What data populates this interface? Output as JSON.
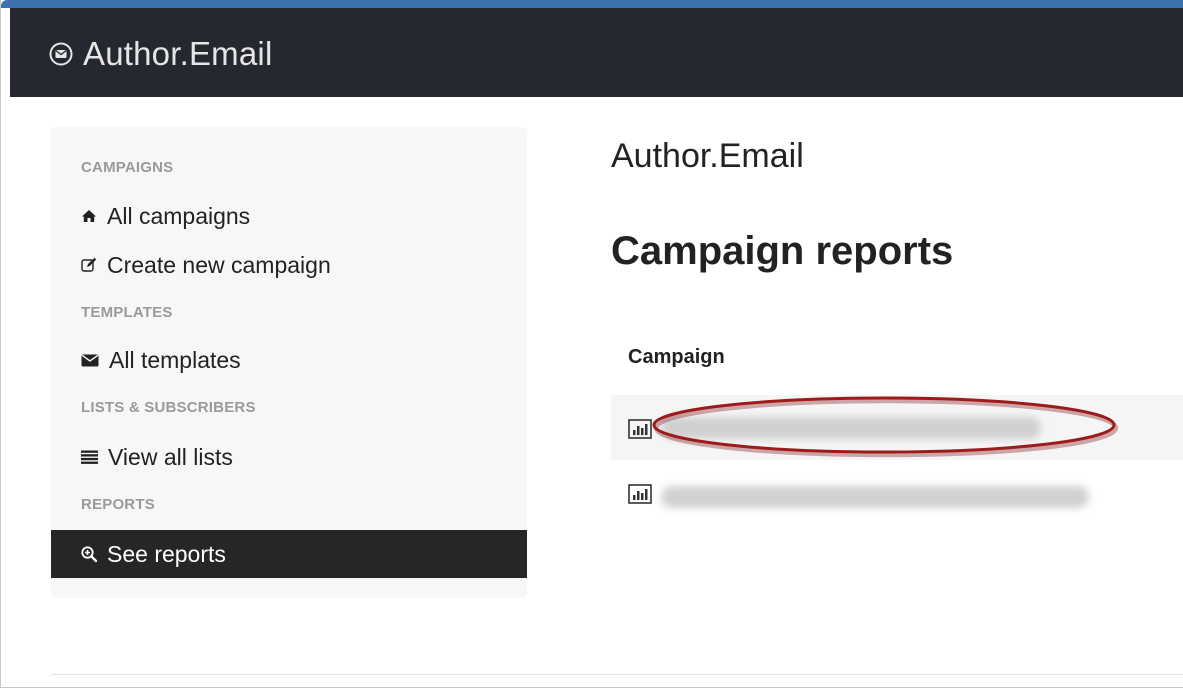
{
  "app": {
    "brand": "Author.Email",
    "brand_icon": "envelope-circle-icon"
  },
  "sidebar": {
    "sections": [
      {
        "header": "CAMPAIGNS"
      },
      {
        "header": "TEMPLATES"
      },
      {
        "header": "LISTS & SUBSCRIBERS"
      },
      {
        "header": "REPORTS"
      }
    ],
    "items": [
      {
        "label": "All campaigns",
        "icon": "home-icon"
      },
      {
        "label": "Create new campaign",
        "icon": "edit-icon"
      },
      {
        "label": "All templates",
        "icon": "envelope-icon"
      },
      {
        "label": "View all lists",
        "icon": "list-icon"
      },
      {
        "label": "See reports",
        "icon": "search-plus-icon",
        "active": true
      }
    ]
  },
  "main": {
    "brand": "Author.Email",
    "title": "Campaign reports",
    "table": {
      "column_header": "Campaign",
      "rows": [
        {
          "icon": "bar-chart-icon",
          "name_blurred": true,
          "highlighted": true
        },
        {
          "icon": "bar-chart-icon",
          "name_blurred": true,
          "highlighted": false
        }
      ]
    }
  },
  "colors": {
    "navbar": "#252830",
    "accent_bar": "#3d73ad",
    "sidebar_bg": "#f7f7f7",
    "active_item_bg": "#262626",
    "highlight_ellipse": "#9e1b1b"
  }
}
